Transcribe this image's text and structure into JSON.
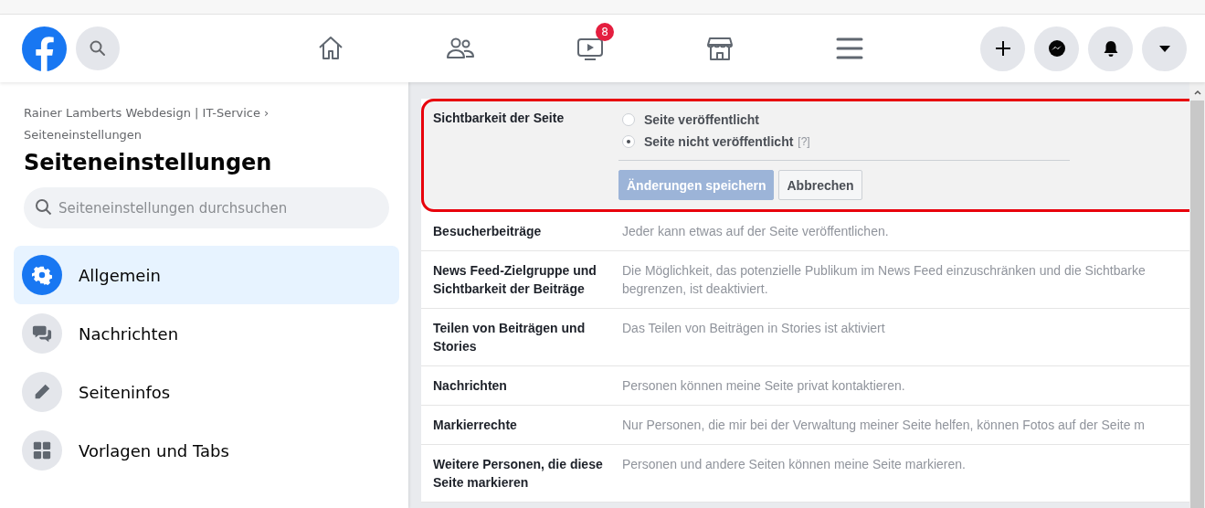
{
  "header": {
    "notification_badge": "8"
  },
  "breadcrumb": {
    "path": "Rainer Lamberts Webdesign | IT-Service ›",
    "current": "Seiteneinstellungen"
  },
  "title": "Seiteneinstellungen",
  "search": {
    "placeholder": "Seiteneinstellungen durchsuchen"
  },
  "sidebar": {
    "items": [
      {
        "label": "Allgemein",
        "selected": true
      },
      {
        "label": "Nachrichten",
        "selected": false
      },
      {
        "label": "Seiteninfos",
        "selected": false
      },
      {
        "label": "Vorlagen und Tabs",
        "selected": false
      }
    ]
  },
  "settings": {
    "rows": [
      {
        "kind": "editor",
        "label": "Sichtbarkeit der Seite",
        "highlighted": true,
        "options": [
          {
            "label": "Seite veröffentlicht",
            "selected": false
          },
          {
            "label": "Seite nicht veröffentlicht",
            "selected": true,
            "help": "[?]"
          }
        ],
        "buttons": [
          {
            "label": "Änderungen speichern",
            "kind": "primary",
            "disabled": true
          },
          {
            "label": "Abbrechen",
            "kind": "secondary",
            "disabled": false
          }
        ]
      },
      {
        "kind": "summary",
        "label": "Besucherbeiträge",
        "description": "Jeder kann etwas auf der Seite veröffentlichen."
      },
      {
        "kind": "summary",
        "label": "News Feed-Zielgruppe und Sichtbarkeit der Beiträge",
        "description": "Die Möglichkeit, das potenzielle Publikum im News Feed einzuschränken und die Sichtbarke\nbegrenzen, ist deaktiviert."
      },
      {
        "kind": "summary",
        "label": "Teilen von Beiträgen und Stories",
        "description": "Das Teilen von Beiträgen in Stories ist aktiviert"
      },
      {
        "kind": "summary",
        "label": "Nachrichten",
        "description": "Personen können meine Seite privat kontaktieren."
      },
      {
        "kind": "summary",
        "label": "Markierrechte",
        "description": "Nur Personen, die mir bei der Verwaltung meiner Seite helfen, können Fotos auf der Seite m"
      },
      {
        "kind": "summary",
        "label": "Weitere Personen, die diese Seite markieren",
        "description": "Personen und andere Seiten können meine Seite markieren."
      }
    ]
  }
}
